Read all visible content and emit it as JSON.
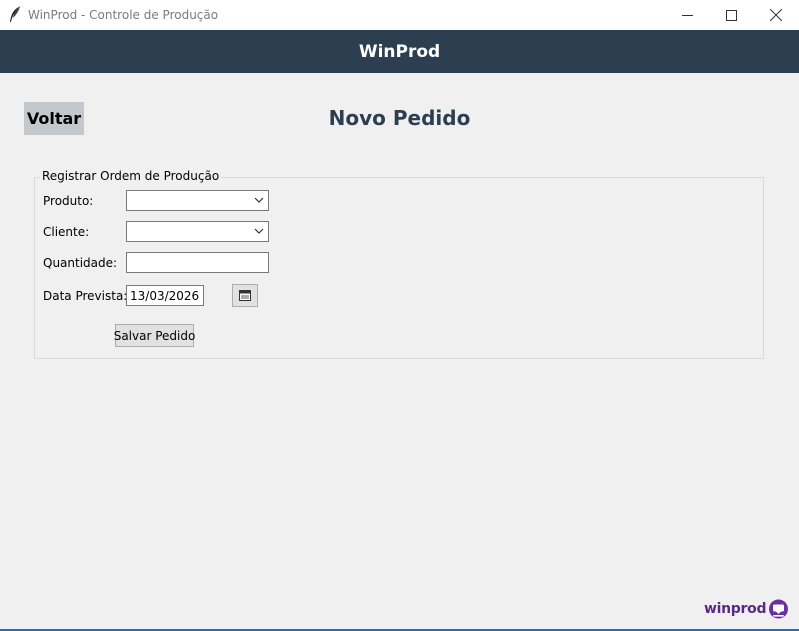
{
  "window": {
    "title": "WinProd - Controle de Produção"
  },
  "header": {
    "title": "WinProd",
    "background": "#2c3e50"
  },
  "nav": {
    "back_label": "Voltar"
  },
  "page": {
    "title": "Novo Pedido"
  },
  "form": {
    "group_title": "Registrar Ordem de Produção",
    "produto": {
      "label": "Produto:",
      "value": ""
    },
    "cliente": {
      "label": "Cliente:",
      "value": ""
    },
    "quantidade": {
      "label": "Quantidade:",
      "value": ""
    },
    "data_prevista": {
      "label": "Data Prevista:",
      "value": "13/03/2026"
    },
    "save_label": "Salvar Pedido"
  },
  "logo": {
    "text": "winprod",
    "color": "#5b2a86"
  },
  "icons": [
    "app-feather-icon",
    "minimize-icon",
    "maximize-icon",
    "close-icon",
    "chevron-down-icon",
    "calendar-icon",
    "chat-bubble-logo-icon"
  ]
}
